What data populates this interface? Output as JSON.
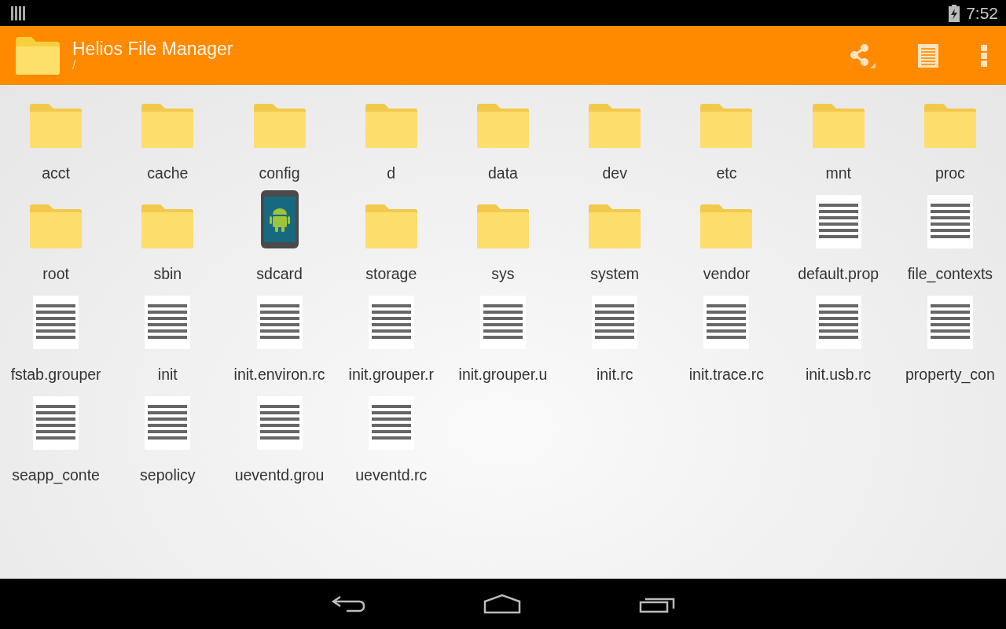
{
  "status_bar": {
    "time": "7:52"
  },
  "app_bar": {
    "title": "Helios File Manager",
    "path": "/"
  },
  "items": [
    {
      "name": "acct",
      "kind": "folder"
    },
    {
      "name": "cache",
      "kind": "folder"
    },
    {
      "name": "config",
      "kind": "folder"
    },
    {
      "name": "d",
      "kind": "folder"
    },
    {
      "name": "data",
      "kind": "folder"
    },
    {
      "name": "dev",
      "kind": "folder"
    },
    {
      "name": "etc",
      "kind": "folder"
    },
    {
      "name": "mnt",
      "kind": "folder"
    },
    {
      "name": "proc",
      "kind": "folder"
    },
    {
      "name": "root",
      "kind": "folder"
    },
    {
      "name": "sbin",
      "kind": "folder"
    },
    {
      "name": "sdcard",
      "kind": "device"
    },
    {
      "name": "storage",
      "kind": "folder"
    },
    {
      "name": "sys",
      "kind": "folder"
    },
    {
      "name": "system",
      "kind": "folder"
    },
    {
      "name": "vendor",
      "kind": "folder"
    },
    {
      "name": "default.prop",
      "kind": "file"
    },
    {
      "name": "file_contexts",
      "kind": "file"
    },
    {
      "name": "fstab.grouper",
      "kind": "file"
    },
    {
      "name": "init",
      "kind": "file"
    },
    {
      "name": "init.environ.rc",
      "kind": "file"
    },
    {
      "name": "init.grouper.r",
      "kind": "file"
    },
    {
      "name": "init.grouper.u",
      "kind": "file"
    },
    {
      "name": "init.rc",
      "kind": "file"
    },
    {
      "name": "init.trace.rc",
      "kind": "file"
    },
    {
      "name": "init.usb.rc",
      "kind": "file"
    },
    {
      "name": "property_con",
      "kind": "file"
    },
    {
      "name": "seapp_conte",
      "kind": "file"
    },
    {
      "name": "sepolicy",
      "kind": "file"
    },
    {
      "name": "ueventd.grou",
      "kind": "file"
    },
    {
      "name": "ueventd.rc",
      "kind": "file"
    }
  ]
}
